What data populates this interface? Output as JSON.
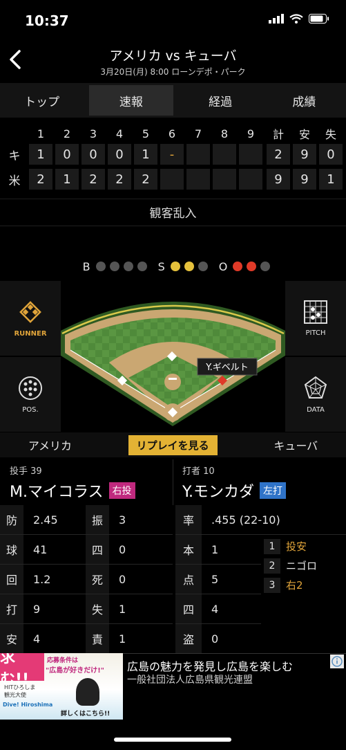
{
  "status": {
    "time": "10:37"
  },
  "header": {
    "title": "アメリカ vs キューバ",
    "subtitle": "3月20日(月) 8:00 ローンデポ・パーク"
  },
  "tabs": [
    "トップ",
    "速報",
    "経過",
    "成績"
  ],
  "scoreboard": {
    "innings": [
      "1",
      "2",
      "3",
      "4",
      "5",
      "6",
      "7",
      "8",
      "9"
    ],
    "totals_headers": [
      "計",
      "安",
      "失"
    ],
    "rows": [
      {
        "team": "キ",
        "scores": [
          "1",
          "0",
          "0",
          "0",
          "1",
          "-",
          "",
          "",
          ""
        ],
        "totals": [
          "2",
          "9",
          "0"
        ]
      },
      {
        "team": "米",
        "scores": [
          "2",
          "1",
          "2",
          "2",
          "2",
          "",
          "",
          "",
          ""
        ],
        "totals": [
          "9",
          "9",
          "1"
        ]
      }
    ]
  },
  "event_text": "観客乱入",
  "event_text2": "",
  "count": {
    "b_label": "B",
    "s_label": "S",
    "o_label": "O",
    "balls": 0,
    "strikes": 2,
    "outs": 2
  },
  "field": {
    "runner_label": "RUNNER",
    "pos_label": "POS.",
    "pitch_label": "PITCH",
    "data_label": "DATA",
    "fielder_tag": "Y.ギベルト"
  },
  "teambar": {
    "left": "アメリカ",
    "replay": "リプレイを見る",
    "right": "キューバ"
  },
  "pitcher": {
    "label": "投手 39",
    "name": "M.マイコラス",
    "badge": "右投"
  },
  "batter": {
    "label": "打者 10",
    "name": "Y.モンカダ",
    "badge": "左打"
  },
  "pitcher_stats": [
    {
      "k": "防",
      "v": "2.45"
    },
    {
      "k": "振",
      "v": "3"
    },
    {
      "k": "球",
      "v": "41"
    },
    {
      "k": "四",
      "v": "0"
    },
    {
      "k": "回",
      "v": "1.2"
    },
    {
      "k": "死",
      "v": "0"
    },
    {
      "k": "打",
      "v": "9"
    },
    {
      "k": "失",
      "v": "1"
    },
    {
      "k": "安",
      "v": "4"
    },
    {
      "k": "責",
      "v": "1"
    }
  ],
  "batter_stats": [
    {
      "k": "率",
      "v": ".455 (22-10)"
    },
    {
      "k": "本",
      "v": "1"
    },
    {
      "k": "点",
      "v": "5"
    },
    {
      "k": "四",
      "v": "4"
    },
    {
      "k": "盗",
      "v": "0"
    }
  ],
  "at_bats": [
    {
      "n": "1",
      "r": "投安"
    },
    {
      "n": "2",
      "r": "ニゴロ"
    },
    {
      "n": "3",
      "r": "右2"
    }
  ],
  "ad": {
    "title": "広島の魅力を発見し広島を楽しむ",
    "sub": "一般社団法人広島県観光連盟",
    "img_big": "求む!!",
    "img_line1": "応募条件は",
    "img_line2": "\"広島が好きだけ!\"",
    "img_small1": "HITひろしま",
    "img_small2": "観光大使",
    "img_cta": "詳しくはこちら!!",
    "img_logo": "Dive! Hiroshima"
  },
  "colors": {
    "accent": "#e3b234",
    "pink": "#c0297e",
    "blue": "#2f73c8",
    "orange": "#e0a43a",
    "red": "#e03a28"
  }
}
